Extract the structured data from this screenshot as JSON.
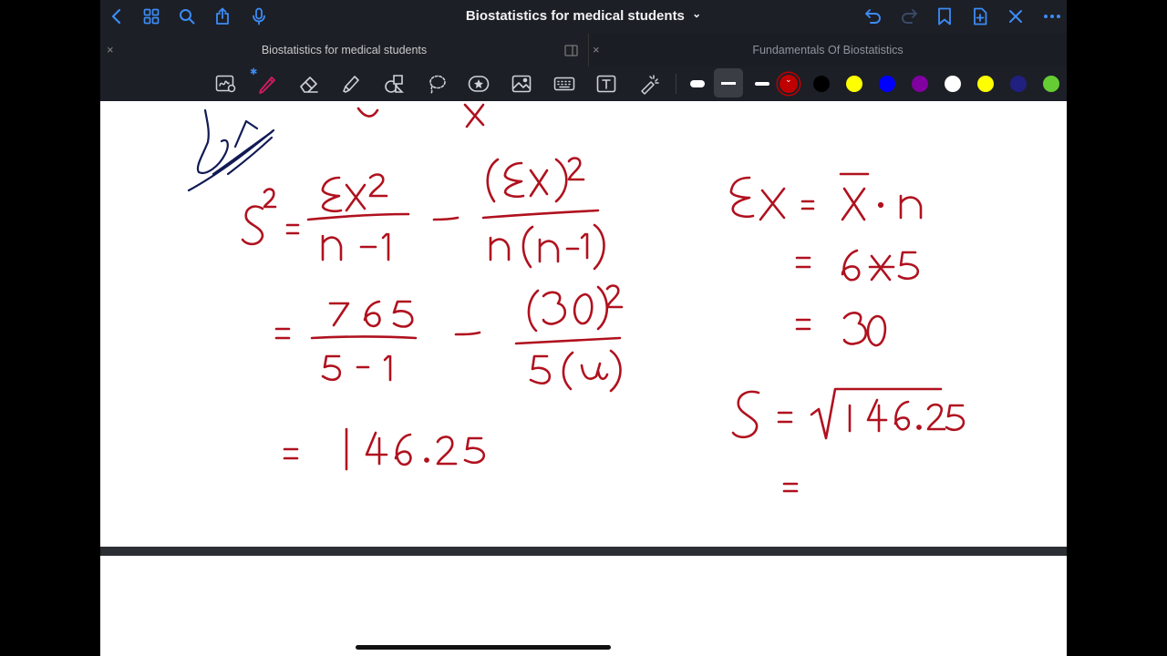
{
  "window": {
    "title": "Biostatistics for medical students",
    "title_chevron": "⌄"
  },
  "tabs": [
    {
      "label": "Biostatistics for medical students",
      "active": true
    },
    {
      "label": "Fundamentals Of Biostatistics",
      "active": false
    }
  ],
  "toolbar": {
    "bluetooth_glyph": "✱",
    "colors": [
      "#c00000",
      "#000000",
      "#ffff00",
      "#0000ff",
      "#8000a0",
      "#ffffff",
      "#ffff00",
      "#202080",
      "#66cc33"
    ],
    "selected_color_glyph": "⌄"
  },
  "ink": {
    "red": "#b0111e",
    "blue": "#111a55"
  }
}
